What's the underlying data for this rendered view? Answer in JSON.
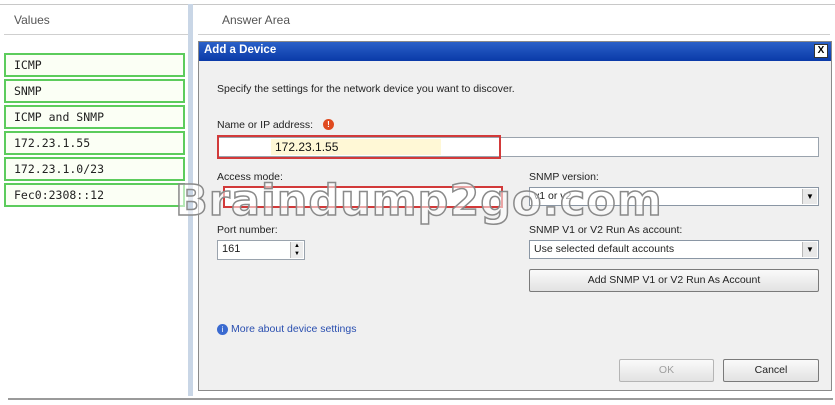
{
  "headers": {
    "values": "Values",
    "answer_area": "Answer Area"
  },
  "values_list": [
    "ICMP",
    "SNMP",
    "ICMP and SNMP",
    "172.23.1.55",
    "172.23.1.0/23",
    "Fec0:2308::12"
  ],
  "dialog": {
    "title": "Add a Device",
    "close_label": "X",
    "instruction": "Specify the settings for the network device you want to discover.",
    "name_label": "Name or IP address:",
    "name_value": "172.23.1.55",
    "access_mode_label": "Access mode:",
    "access_mode_value": "",
    "snmp_version_label": "SNMP version:",
    "snmp_version_value": "v1 or v2",
    "port_label": "Port number:",
    "port_value": "161",
    "runas_label": "SNMP V1 or V2 Run As account:",
    "runas_value": "Use selected default accounts",
    "add_runas_button": "Add SNMP V1 or V2 Run As Account",
    "more_link": "More about device settings",
    "ok_button": "OK",
    "cancel_button": "Cancel"
  },
  "watermark": "Braindump2go.com",
  "colors": {
    "title_bar": "#0a3aa8",
    "value_border": "#5ccc5c",
    "answer_box": "#d23a3a",
    "link": "#2a4fb0"
  }
}
